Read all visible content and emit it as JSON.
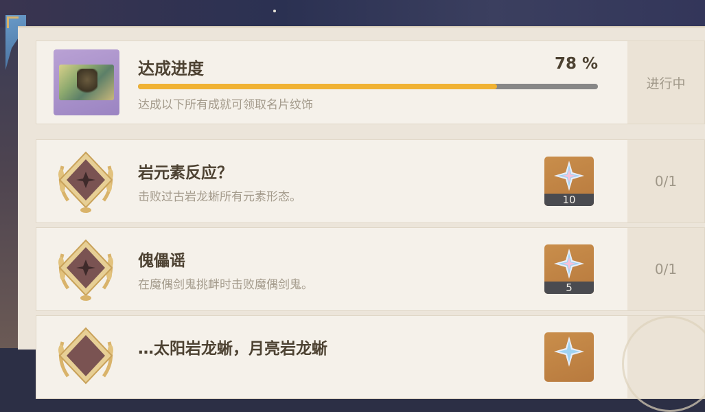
{
  "summary": {
    "title": "达成进度",
    "percent_text": "78 %",
    "progress": 0.78,
    "description": "达成以下所有成就可领取名片纹饰",
    "status": "进行中"
  },
  "achievements": [
    {
      "name": "岩元素反应？",
      "description": "击败过古岩龙蜥所有元素形态。",
      "reward_count": "10",
      "progress": "0/1"
    },
    {
      "name": "傀儡谣",
      "description": "在魔偶剑鬼挑衅时击败魔偶剑鬼。",
      "reward_count": "5",
      "progress": "0/1"
    },
    {
      "name": "…太阳岩龙蜥，月亮岩龙蜥",
      "description": "",
      "reward_count": "",
      "progress": ""
    }
  ],
  "colors": {
    "progress_fill": "#f0b233",
    "reward_bg": "#c98e4b",
    "panel_bg": "#ece5da"
  },
  "icons": [
    "primogem-icon",
    "achievement-medal-icon",
    "namecard-thumbnail"
  ]
}
